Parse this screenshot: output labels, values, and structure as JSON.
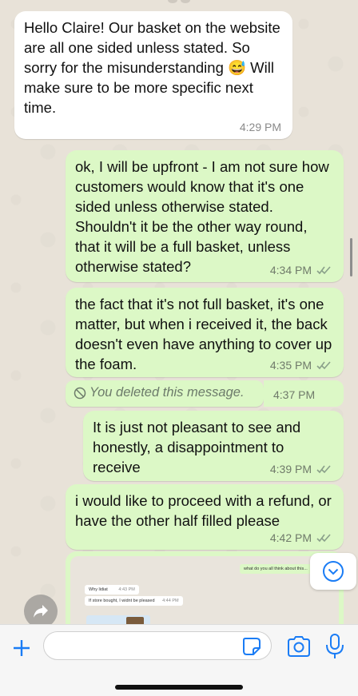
{
  "colors": {
    "incoming": "#ffffff",
    "outgoing": "#dcf8c6",
    "accent": "#1a7cf5",
    "ticks": "#8aa08a"
  },
  "messages": [
    {
      "direction": "in",
      "text": "Hello Claire! Our basket on the website are all one sided unless stated. So sorry for the misunderstanding 😅 Will make sure to be more specific next time.",
      "time": "4:29 PM"
    },
    {
      "direction": "out",
      "text": "ok, I will be upfront - I am not sure how customers would know that it's one sided unless otherwise stated. Shouldn't it be the other way round, that it will be a full basket, unless otherwise stated?",
      "time": "4:34 PM",
      "status_icon": "double-check-icon"
    },
    {
      "direction": "out",
      "text": "the fact that it's not full basket, it's one matter, but when i received it, the back doesn't even have anything to cover up the foam.",
      "time": "4:35 PM",
      "status_icon": "double-check-icon"
    },
    {
      "direction": "out",
      "deleted": true,
      "text": "You deleted this message.",
      "time": "4:37 PM",
      "icon": "ban-icon"
    },
    {
      "direction": "out",
      "text": "It is just not pleasant to see and honestly, a disappointment to receive",
      "time": "4:39 PM",
      "status_icon": "double-check-icon"
    },
    {
      "direction": "out",
      "text": "i would like to proceed with a refund, or have the other half filled please",
      "time": "4:42 PM",
      "status_icon": "double-check-icon"
    }
  ],
  "image_message": {
    "preview_lines": [
      {
        "text": "what do you all think about this..."
      },
      {
        "text": "Why lidiat"
      },
      {
        "text": "4:43 PM"
      },
      {
        "text": "If store bought, I widnt be pleased"
      },
      {
        "text": "4:44 PM"
      }
    ]
  },
  "controls": {
    "forward_icon": "forward-icon",
    "scroll_down_icon": "chevron-down-icon"
  },
  "input_bar": {
    "placeholder": "",
    "plus_icon": "plus-icon",
    "sticker_icon": "sticker-icon",
    "camera_icon": "camera-icon",
    "mic_icon": "microphone-icon"
  }
}
